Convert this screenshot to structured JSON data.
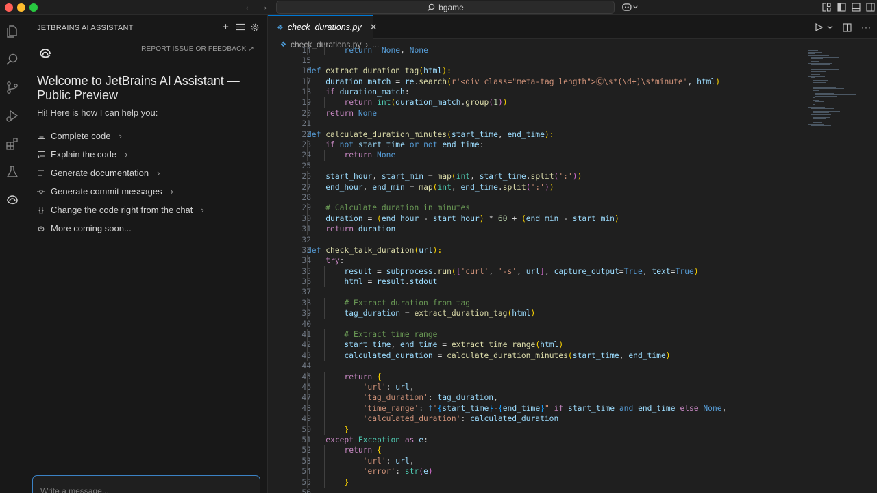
{
  "titlebar": {
    "search_text": "bgame"
  },
  "ai_panel": {
    "title": "JETBRAINS AI ASSISTANT",
    "report_link": "REPORT ISSUE OR FEEDBACK ↗",
    "welcome_heading": "Welcome to JetBrains AI Assistant — Public Preview",
    "intro": "Hi! Here is how I can help you:",
    "features": [
      {
        "label": "Complete code",
        "icon": "keyboard-icon",
        "has_chevron": true
      },
      {
        "label": "Explain the code",
        "icon": "chat-bubble-icon",
        "has_chevron": true
      },
      {
        "label": "Generate documentation",
        "icon": "lines-icon",
        "has_chevron": true
      },
      {
        "label": "Generate commit messages",
        "icon": "commit-icon",
        "has_chevron": true
      },
      {
        "label": "Change the code right from the chat",
        "icon": "braces-icon",
        "has_chevron": true
      },
      {
        "label": "More coming soon...",
        "icon": "spiral-icon",
        "has_chevron": false
      }
    ],
    "input_placeholder": "Write a message..."
  },
  "editor": {
    "tab_label": "check_durations.py",
    "breadcrumb_file": "check_durations.py",
    "breadcrumb_more": "...",
    "code": [
      {
        "n": 14,
        "indent": 2,
        "t": [
          [
            "kw",
            "return"
          ],
          [
            "",
            "  "
          ],
          [
            "kw",
            "None"
          ],
          [
            "",
            ", "
          ],
          [
            "kw",
            "None"
          ]
        ]
      },
      {
        "n": 15,
        "indent": 0,
        "t": []
      },
      {
        "n": 16,
        "indent": 0,
        "t": [
          [
            "kw",
            "def"
          ],
          [
            "",
            " "
          ],
          [
            "fn",
            "extract_duration_tag"
          ],
          [
            "br1",
            "("
          ],
          [
            "var",
            "html"
          ],
          [
            "br1",
            "):"
          ]
        ]
      },
      {
        "n": 17,
        "indent": 1,
        "t": [
          [
            "var",
            "duration_match"
          ],
          [
            "op",
            " = "
          ],
          [
            "var",
            "re"
          ],
          [
            "",
            "."
          ],
          [
            "fn",
            "search"
          ],
          [
            "br1",
            "("
          ],
          [
            "str",
            "r'<div class=\"meta-tag length\">Ⓒ\\s*(\\d+)\\s*minute'"
          ],
          [
            "",
            ", "
          ],
          [
            "var",
            "html"
          ],
          [
            "br1",
            ")"
          ]
        ]
      },
      {
        "n": 18,
        "indent": 1,
        "t": [
          [
            "ctrl",
            "if"
          ],
          [
            "",
            " "
          ],
          [
            "var",
            "duration_match"
          ],
          [
            "",
            ":"
          ]
        ]
      },
      {
        "n": 19,
        "indent": 2,
        "t": [
          [
            "ctrl",
            "return"
          ],
          [
            "",
            " "
          ],
          [
            "cls",
            "int"
          ],
          [
            "br1",
            "("
          ],
          [
            "var",
            "duration_match"
          ],
          [
            "",
            "."
          ],
          [
            "fn",
            "group"
          ],
          [
            "br2",
            "("
          ],
          [
            "num",
            "1"
          ],
          [
            "br2",
            ")"
          ],
          [
            "br1",
            ")"
          ]
        ]
      },
      {
        "n": 20,
        "indent": 1,
        "t": [
          [
            "ctrl",
            "return"
          ],
          [
            "",
            " "
          ],
          [
            "kw",
            "None"
          ]
        ]
      },
      {
        "n": 21,
        "indent": 0,
        "t": []
      },
      {
        "n": 22,
        "indent": 0,
        "t": [
          [
            "kw",
            "def"
          ],
          [
            "",
            " "
          ],
          [
            "fn",
            "calculate_duration_minutes"
          ],
          [
            "br1",
            "("
          ],
          [
            "var",
            "start_time"
          ],
          [
            "",
            ", "
          ],
          [
            "var",
            "end_time"
          ],
          [
            "br1",
            "):"
          ]
        ]
      },
      {
        "n": 23,
        "indent": 1,
        "t": [
          [
            "ctrl",
            "if"
          ],
          [
            "",
            " "
          ],
          [
            "kw",
            "not"
          ],
          [
            "",
            " "
          ],
          [
            "var",
            "start_time"
          ],
          [
            "",
            " "
          ],
          [
            "kw",
            "or"
          ],
          [
            "",
            " "
          ],
          [
            "kw",
            "not"
          ],
          [
            "",
            " "
          ],
          [
            "var",
            "end_time"
          ],
          [
            "",
            ":"
          ]
        ]
      },
      {
        "n": 24,
        "indent": 2,
        "t": [
          [
            "ctrl",
            "return"
          ],
          [
            "",
            " "
          ],
          [
            "kw",
            "None"
          ]
        ]
      },
      {
        "n": 25,
        "indent": 0,
        "t": []
      },
      {
        "n": 26,
        "indent": 1,
        "t": [
          [
            "var",
            "start_hour"
          ],
          [
            "",
            ", "
          ],
          [
            "var",
            "start_min"
          ],
          [
            "op",
            " = "
          ],
          [
            "fn",
            "map"
          ],
          [
            "br1",
            "("
          ],
          [
            "cls",
            "int"
          ],
          [
            "",
            ", "
          ],
          [
            "var",
            "start_time"
          ],
          [
            "",
            "."
          ],
          [
            "fn",
            "split"
          ],
          [
            "br2",
            "("
          ],
          [
            "str",
            "':'"
          ],
          [
            "br2",
            ")"
          ],
          [
            "br1",
            ")"
          ]
        ]
      },
      {
        "n": 27,
        "indent": 1,
        "t": [
          [
            "var",
            "end_hour"
          ],
          [
            "",
            ", "
          ],
          [
            "var",
            "end_min"
          ],
          [
            "op",
            " = "
          ],
          [
            "fn",
            "map"
          ],
          [
            "br1",
            "("
          ],
          [
            "cls",
            "int"
          ],
          [
            "",
            ", "
          ],
          [
            "var",
            "end_time"
          ],
          [
            "",
            "."
          ],
          [
            "fn",
            "split"
          ],
          [
            "br2",
            "("
          ],
          [
            "str",
            "':'"
          ],
          [
            "br2",
            ")"
          ],
          [
            "br1",
            ")"
          ]
        ]
      },
      {
        "n": 28,
        "indent": 0,
        "t": []
      },
      {
        "n": 29,
        "indent": 1,
        "t": [
          [
            "cmt",
            "# Calculate duration in minutes"
          ]
        ]
      },
      {
        "n": 30,
        "indent": 1,
        "t": [
          [
            "var",
            "duration"
          ],
          [
            "op",
            " = "
          ],
          [
            "br1",
            "("
          ],
          [
            "var",
            "end_hour"
          ],
          [
            "op",
            " - "
          ],
          [
            "var",
            "start_hour"
          ],
          [
            "br1",
            ")"
          ],
          [
            "op",
            " * "
          ],
          [
            "num",
            "60"
          ],
          [
            "op",
            " + "
          ],
          [
            "br1",
            "("
          ],
          [
            "var",
            "end_min"
          ],
          [
            "op",
            " - "
          ],
          [
            "var",
            "start_min"
          ],
          [
            "br1",
            ")"
          ]
        ]
      },
      {
        "n": 31,
        "indent": 1,
        "t": [
          [
            "ctrl",
            "return"
          ],
          [
            "",
            " "
          ],
          [
            "var",
            "duration"
          ]
        ]
      },
      {
        "n": 32,
        "indent": 0,
        "t": []
      },
      {
        "n": 33,
        "indent": 0,
        "t": [
          [
            "kw",
            "def"
          ],
          [
            "",
            " "
          ],
          [
            "fn",
            "check_talk_duration"
          ],
          [
            "br1",
            "("
          ],
          [
            "var",
            "url"
          ],
          [
            "br1",
            "):"
          ]
        ]
      },
      {
        "n": 34,
        "indent": 1,
        "t": [
          [
            "ctrl",
            "try"
          ],
          [
            "",
            ":"
          ]
        ]
      },
      {
        "n": 35,
        "indent": 2,
        "t": [
          [
            "var",
            "result"
          ],
          [
            "op",
            " = "
          ],
          [
            "var",
            "subprocess"
          ],
          [
            "",
            "."
          ],
          [
            "fn",
            "run"
          ],
          [
            "br1",
            "("
          ],
          [
            "br2",
            "["
          ],
          [
            "str",
            "'curl'"
          ],
          [
            "",
            ", "
          ],
          [
            "str",
            "'-s'"
          ],
          [
            "",
            ", "
          ],
          [
            "var",
            "url"
          ],
          [
            "br2",
            "]"
          ],
          [
            "",
            ", "
          ],
          [
            "var",
            "capture_output"
          ],
          [
            "op",
            "="
          ],
          [
            "kw",
            "True"
          ],
          [
            "",
            ", "
          ],
          [
            "var",
            "text"
          ],
          [
            "op",
            "="
          ],
          [
            "kw",
            "True"
          ],
          [
            "br1",
            ")"
          ]
        ]
      },
      {
        "n": 36,
        "indent": 2,
        "t": [
          [
            "var",
            "html"
          ],
          [
            "op",
            " = "
          ],
          [
            "var",
            "result"
          ],
          [
            "",
            "."
          ],
          [
            "var",
            "stdout"
          ]
        ]
      },
      {
        "n": 37,
        "indent": 0,
        "t": []
      },
      {
        "n": 38,
        "indent": 2,
        "t": [
          [
            "cmt",
            "# Extract duration from tag"
          ]
        ]
      },
      {
        "n": 39,
        "indent": 2,
        "t": [
          [
            "var",
            "tag_duration"
          ],
          [
            "op",
            " = "
          ],
          [
            "fn",
            "extract_duration_tag"
          ],
          [
            "br1",
            "("
          ],
          [
            "var",
            "html"
          ],
          [
            "br1",
            ")"
          ]
        ]
      },
      {
        "n": 40,
        "indent": 0,
        "t": []
      },
      {
        "n": 41,
        "indent": 2,
        "t": [
          [
            "cmt",
            "# Extract time range"
          ]
        ]
      },
      {
        "n": 42,
        "indent": 2,
        "t": [
          [
            "var",
            "start_time"
          ],
          [
            "",
            ", "
          ],
          [
            "var",
            "end_time"
          ],
          [
            "op",
            " = "
          ],
          [
            "fn",
            "extract_time_range"
          ],
          [
            "br1",
            "("
          ],
          [
            "var",
            "html"
          ],
          [
            "br1",
            ")"
          ]
        ]
      },
      {
        "n": 43,
        "indent": 2,
        "t": [
          [
            "var",
            "calculated_duration"
          ],
          [
            "op",
            " = "
          ],
          [
            "fn",
            "calculate_duration_minutes"
          ],
          [
            "br1",
            "("
          ],
          [
            "var",
            "start_time"
          ],
          [
            "",
            ", "
          ],
          [
            "var",
            "end_time"
          ],
          [
            "br1",
            ")"
          ]
        ]
      },
      {
        "n": 44,
        "indent": 0,
        "t": []
      },
      {
        "n": 45,
        "indent": 2,
        "t": [
          [
            "ctrl",
            "return"
          ],
          [
            "",
            " "
          ],
          [
            "br1",
            "{"
          ]
        ]
      },
      {
        "n": 46,
        "indent": 3,
        "t": [
          [
            "str",
            "'url'"
          ],
          [
            "",
            ": "
          ],
          [
            "var",
            "url"
          ],
          [
            "",
            ","
          ]
        ]
      },
      {
        "n": 47,
        "indent": 3,
        "t": [
          [
            "str",
            "'tag_duration'"
          ],
          [
            "",
            ": "
          ],
          [
            "var",
            "tag_duration"
          ],
          [
            "",
            ","
          ]
        ]
      },
      {
        "n": 48,
        "indent": 3,
        "t": [
          [
            "str",
            "'time_range'"
          ],
          [
            "",
            ": "
          ],
          [
            "kw",
            "f"
          ],
          [
            "str",
            "\""
          ],
          [
            "br3",
            "{"
          ],
          [
            "var",
            "start_time"
          ],
          [
            "br3",
            "}"
          ],
          [
            "str",
            "-"
          ],
          [
            "br3",
            "{"
          ],
          [
            "var",
            "end_time"
          ],
          [
            "br3",
            "}"
          ],
          [
            "str",
            "\""
          ],
          [
            "",
            " "
          ],
          [
            "ctrl",
            "if"
          ],
          [
            "",
            " "
          ],
          [
            "var",
            "start_time"
          ],
          [
            "",
            " "
          ],
          [
            "kw",
            "and"
          ],
          [
            "",
            " "
          ],
          [
            "var",
            "end_time"
          ],
          [
            "",
            " "
          ],
          [
            "ctrl",
            "else"
          ],
          [
            "",
            " "
          ],
          [
            "kw",
            "None"
          ],
          [
            "",
            ","
          ]
        ]
      },
      {
        "n": 49,
        "indent": 3,
        "t": [
          [
            "str",
            "'calculated_duration'"
          ],
          [
            "",
            ": "
          ],
          [
            "var",
            "calculated_duration"
          ]
        ]
      },
      {
        "n": 50,
        "indent": 2,
        "t": [
          [
            "br1",
            "}"
          ]
        ]
      },
      {
        "n": 51,
        "indent": 1,
        "t": [
          [
            "ctrl",
            "except"
          ],
          [
            "",
            " "
          ],
          [
            "cls",
            "Exception"
          ],
          [
            "",
            " "
          ],
          [
            "ctrl",
            "as"
          ],
          [
            "",
            " "
          ],
          [
            "var",
            "e"
          ],
          [
            "",
            ":"
          ]
        ]
      },
      {
        "n": 52,
        "indent": 2,
        "t": [
          [
            "ctrl",
            "return"
          ],
          [
            "",
            " "
          ],
          [
            "br1",
            "{"
          ]
        ]
      },
      {
        "n": 53,
        "indent": 3,
        "t": [
          [
            "str",
            "'url'"
          ],
          [
            "",
            ": "
          ],
          [
            "var",
            "url"
          ],
          [
            "",
            ","
          ]
        ]
      },
      {
        "n": 54,
        "indent": 3,
        "t": [
          [
            "str",
            "'error'"
          ],
          [
            "",
            ": "
          ],
          [
            "cls",
            "str"
          ],
          [
            "br2",
            "("
          ],
          [
            "var",
            "e"
          ],
          [
            "br2",
            ")"
          ]
        ]
      },
      {
        "n": 55,
        "indent": 2,
        "t": [
          [
            "br1",
            "}"
          ]
        ]
      },
      {
        "n": 56,
        "indent": 0,
        "t": []
      }
    ]
  },
  "colors": {
    "accent": "#0078d4",
    "chat_border": "#3b82c4",
    "python_icon": "#4d9cd9",
    "traffic_red": "#ff5f57",
    "traffic_yellow": "#febc2e",
    "traffic_green": "#28c840"
  }
}
